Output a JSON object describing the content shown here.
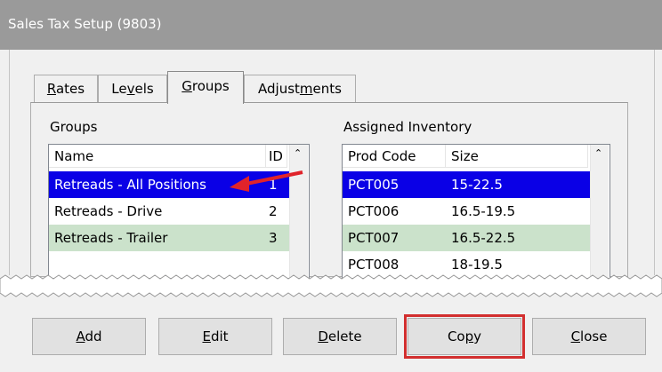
{
  "window": {
    "title": "Sales Tax Setup (9803)"
  },
  "tabs": [
    {
      "label_pre": "",
      "label_u": "R",
      "label_post": "ates"
    },
    {
      "label_pre": "Le",
      "label_u": "v",
      "label_post": "els"
    },
    {
      "label_pre": "",
      "label_u": "G",
      "label_post": "roups"
    },
    {
      "label_pre": "Adjust",
      "label_u": "m",
      "label_post": "ents"
    }
  ],
  "groups": {
    "label": "Groups",
    "headers": {
      "name": "Name",
      "id": "ID"
    },
    "rows": [
      {
        "name": "Retreads - All Positions",
        "id": "1"
      },
      {
        "name": "Retreads - Drive",
        "id": "2"
      },
      {
        "name": "Retreads - Trailer",
        "id": "3"
      }
    ]
  },
  "inventory": {
    "label": "Assigned Inventory",
    "headers": {
      "code": "Prod Code",
      "size": "Size"
    },
    "rows": [
      {
        "code": "PCT005",
        "size": "15-22.5"
      },
      {
        "code": "PCT006",
        "size": "16.5-19.5"
      },
      {
        "code": "PCT007",
        "size": "16.5-22.5"
      },
      {
        "code": "PCT008",
        "size": "18-19.5"
      }
    ]
  },
  "buttons": [
    {
      "pre": "",
      "u": "A",
      "post": "dd"
    },
    {
      "pre": "",
      "u": "E",
      "post": "dit"
    },
    {
      "pre": "",
      "u": "D",
      "post": "elete"
    },
    {
      "pre": "Co",
      "u": "p",
      "post": "y"
    },
    {
      "pre": "",
      "u": "C",
      "post": "lose"
    }
  ],
  "colors": {
    "selected": "#0a00e6",
    "alternate": "#cbe2cb",
    "highlight": "#d22f2f",
    "arrow": "#e0232a"
  }
}
